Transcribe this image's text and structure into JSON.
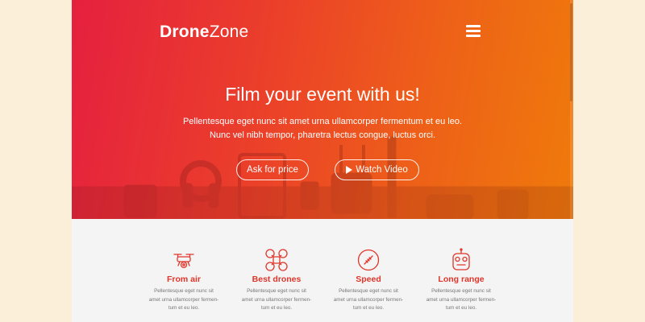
{
  "brand": {
    "bold": "Drone",
    "light": "Zone"
  },
  "nav": {
    "menu_icon": "hamburger-icon"
  },
  "hero": {
    "title": "Film your event with us!",
    "line1": "Pellentesque eget nunc sit amet urna ullamcorper fermentum et eu leo.",
    "line2": "Nunc vel nibh tempor, pharetra lectus congue, luctus orci.",
    "ask_label": "Ask for price",
    "watch_label": "Watch Video"
  },
  "features": [
    {
      "icon": "drone-icon",
      "title": "From air",
      "desc1": "Pellentesque eget nunc sit",
      "desc2": "amet urna ullamcorper fermen-",
      "desc3": "tum et eu leo."
    },
    {
      "icon": "quadcopter-icon",
      "title": "Best drones",
      "desc1": "Pellentesque eget nunc sit",
      "desc2": "amet urna ullamcorper fermen-",
      "desc3": "tum et eu leo."
    },
    {
      "icon": "speed-icon",
      "title": "Speed",
      "desc1": "Pellentesque eget nunc sit",
      "desc2": "amet urna ullamcorper fermen-",
      "desc3": "tum et eu leo."
    },
    {
      "icon": "remote-control-icon",
      "title": "Long range",
      "desc1": "Pellentesque eget nunc sit",
      "desc2": "amet urna ullamcorper fermen-",
      "desc3": "tum et eu leo."
    }
  ],
  "colors": {
    "accent": "#e0352a",
    "hero_start": "#e5203f",
    "hero_end": "#ef7a0b",
    "page_bg": "#fcefd9"
  }
}
